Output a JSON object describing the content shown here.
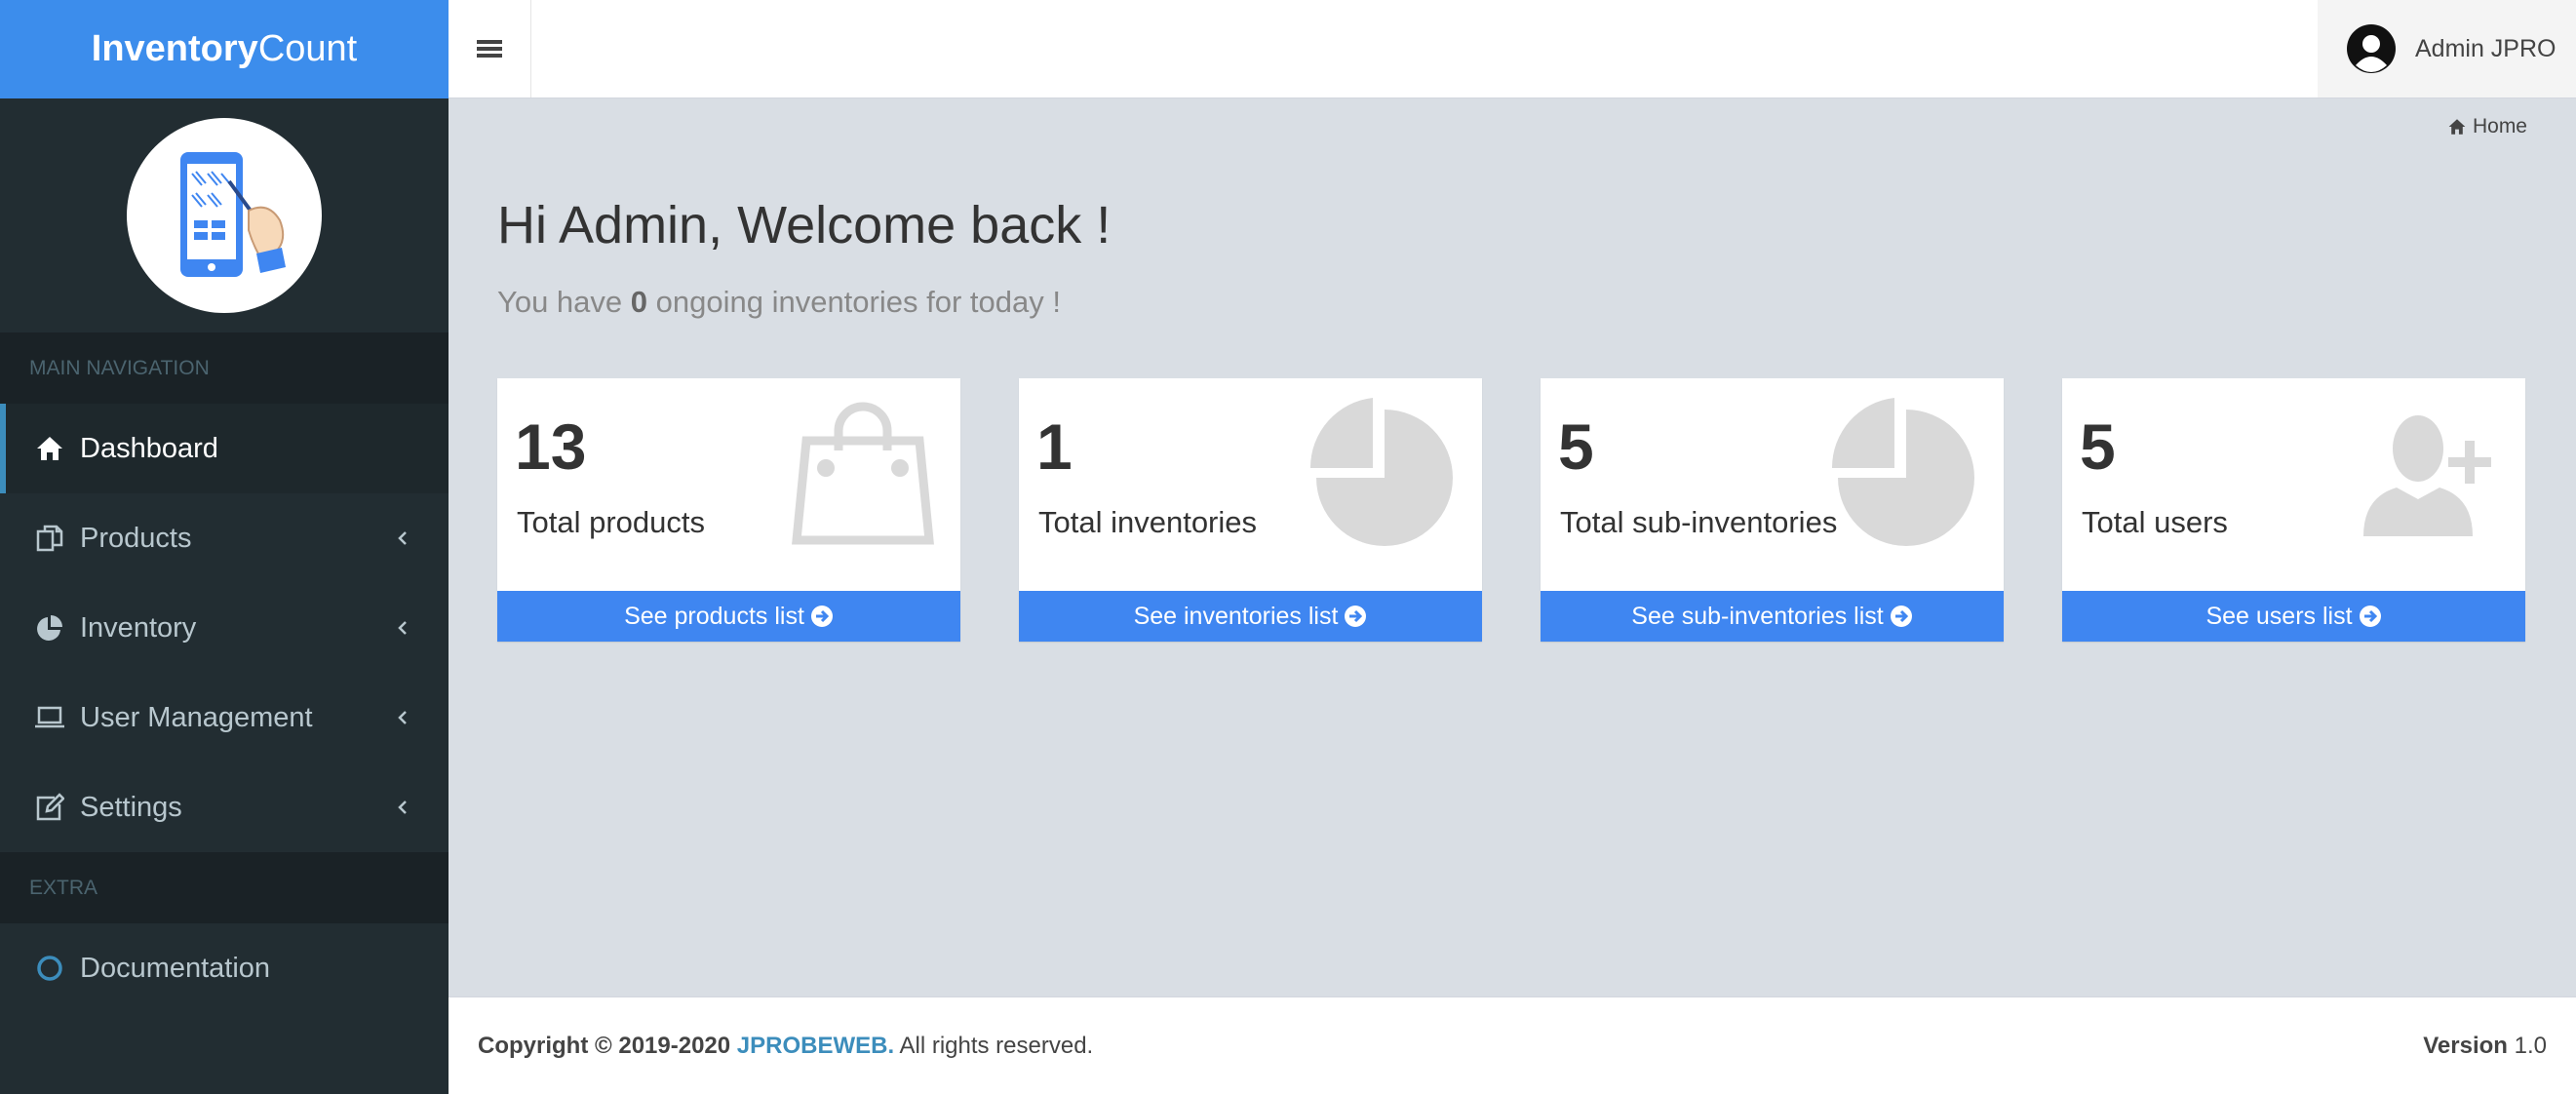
{
  "app": {
    "logo_bold": "Inventory",
    "logo_light": "Count"
  },
  "colors": {
    "brand_blue": "#3c8dec",
    "sidebar_bg": "#222d32",
    "card_footer": "#3f86f1",
    "content_bg": "#d9dee4"
  },
  "sidebar": {
    "main_nav_header": "MAIN NAVIGATION",
    "extra_header": "EXTRA",
    "items": [
      {
        "label": "Dashboard",
        "icon": "home-icon",
        "active": true
      },
      {
        "label": "Products",
        "icon": "copy-icon"
      },
      {
        "label": "Inventory",
        "icon": "pie-chart-icon"
      },
      {
        "label": "User Management",
        "icon": "laptop-icon"
      },
      {
        "label": "Settings",
        "icon": "edit-icon"
      }
    ],
    "extra_items": [
      {
        "label": "Documentation",
        "icon": "circle-icon"
      }
    ]
  },
  "topbar": {
    "user_name": "Admin JPRO"
  },
  "breadcrumb": {
    "home": "Home"
  },
  "welcome": {
    "title": "Hi Admin, Welcome back !",
    "sub_prefix": "You have ",
    "ongoing_count": "0",
    "sub_suffix": " ongoing inventories for today !"
  },
  "cards": [
    {
      "count": "13",
      "label": "Total products",
      "link": "See products list",
      "icon": "shopping-bag-icon"
    },
    {
      "count": "1",
      "label": "Total inventories",
      "link": "See inventories list",
      "icon": "pie-chart-icon"
    },
    {
      "count": "5",
      "label": "Total sub-inventories",
      "link": "See sub-inventories list",
      "icon": "pie-chart-icon"
    },
    {
      "count": "5",
      "label": "Total users",
      "link": "See users list",
      "icon": "user-plus-icon"
    }
  ],
  "footer": {
    "copyright_prefix": "Copyright © 2019-2020 ",
    "brand": "JPROBEWEB.",
    "rights": " All rights reserved.",
    "version_label": "Version",
    "version_number": " 1.0"
  }
}
